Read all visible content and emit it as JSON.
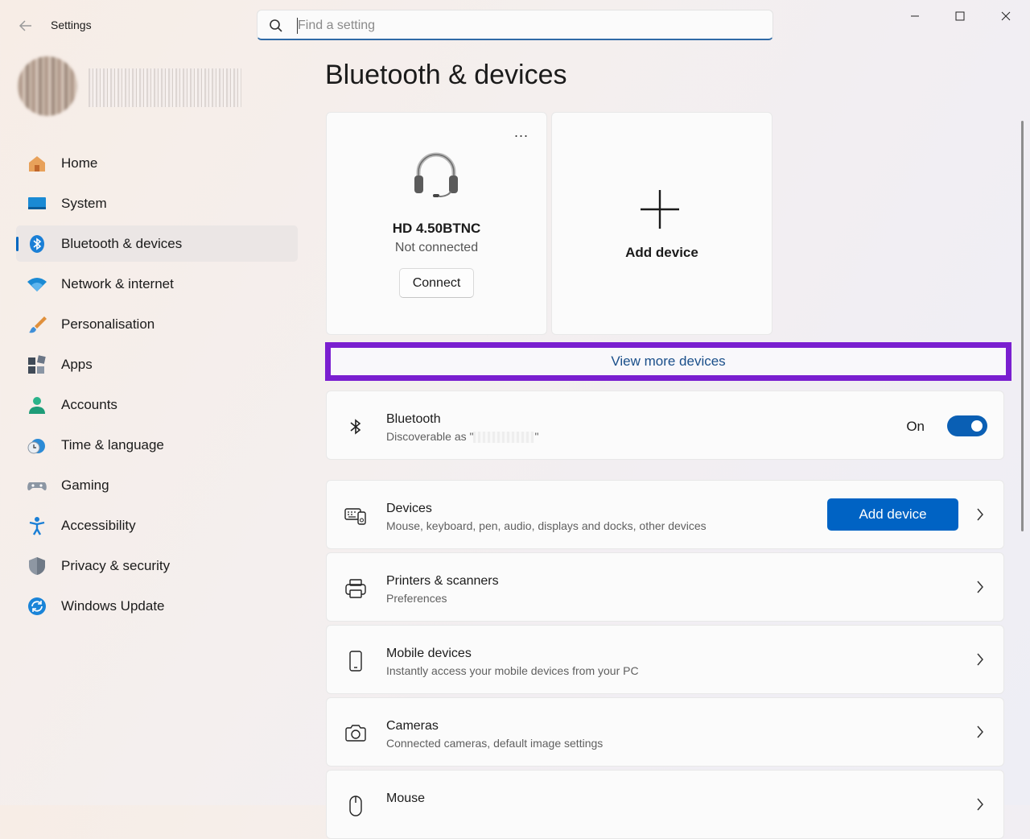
{
  "window": {
    "title": "Settings",
    "controls": [
      "minimize",
      "maximize",
      "close"
    ]
  },
  "search": {
    "placeholder": "Find a setting",
    "value": ""
  },
  "sidebar": {
    "items": [
      {
        "label": "Home",
        "icon": "home-icon"
      },
      {
        "label": "System",
        "icon": "system-icon"
      },
      {
        "label": "Bluetooth & devices",
        "icon": "bluetooth-icon",
        "selected": true
      },
      {
        "label": "Network & internet",
        "icon": "wifi-icon"
      },
      {
        "label": "Personalisation",
        "icon": "brush-icon"
      },
      {
        "label": "Apps",
        "icon": "apps-icon"
      },
      {
        "label": "Accounts",
        "icon": "accounts-icon"
      },
      {
        "label": "Time & language",
        "icon": "clock-globe-icon"
      },
      {
        "label": "Gaming",
        "icon": "gamepad-icon"
      },
      {
        "label": "Accessibility",
        "icon": "accessibility-icon"
      },
      {
        "label": "Privacy & security",
        "icon": "shield-icon"
      },
      {
        "label": "Windows Update",
        "icon": "update-icon"
      }
    ]
  },
  "main": {
    "title": "Bluetooth & devices",
    "device_card": {
      "name": "HD 4.50BTNC",
      "status": "Not connected",
      "action": "Connect",
      "more": "..."
    },
    "add_card": {
      "label": "Add device"
    },
    "view_more": "View more devices",
    "bluetooth": {
      "title": "Bluetooth",
      "subtitle_prefix": "Discoverable as \"",
      "subtitle_suffix": "\"",
      "toggle_label": "On",
      "toggle_on": true
    },
    "rows": [
      {
        "title": "Devices",
        "subtitle": "Mouse, keyboard, pen, audio, displays and docks, other devices",
        "button": "Add device",
        "icon": "devices-icon"
      },
      {
        "title": "Printers & scanners",
        "subtitle": "Preferences",
        "icon": "printer-icon"
      },
      {
        "title": "Mobile devices",
        "subtitle": "Instantly access your mobile devices from your PC",
        "icon": "phone-icon"
      },
      {
        "title": "Cameras",
        "subtitle": "Connected cameras, default image settings",
        "icon": "camera-icon"
      },
      {
        "title": "Mouse",
        "subtitle": "",
        "icon": "mouse-icon"
      }
    ]
  },
  "colors": {
    "accent": "#0063c4",
    "highlight_box": "#7a1fd0",
    "link": "#1a4f8a"
  }
}
